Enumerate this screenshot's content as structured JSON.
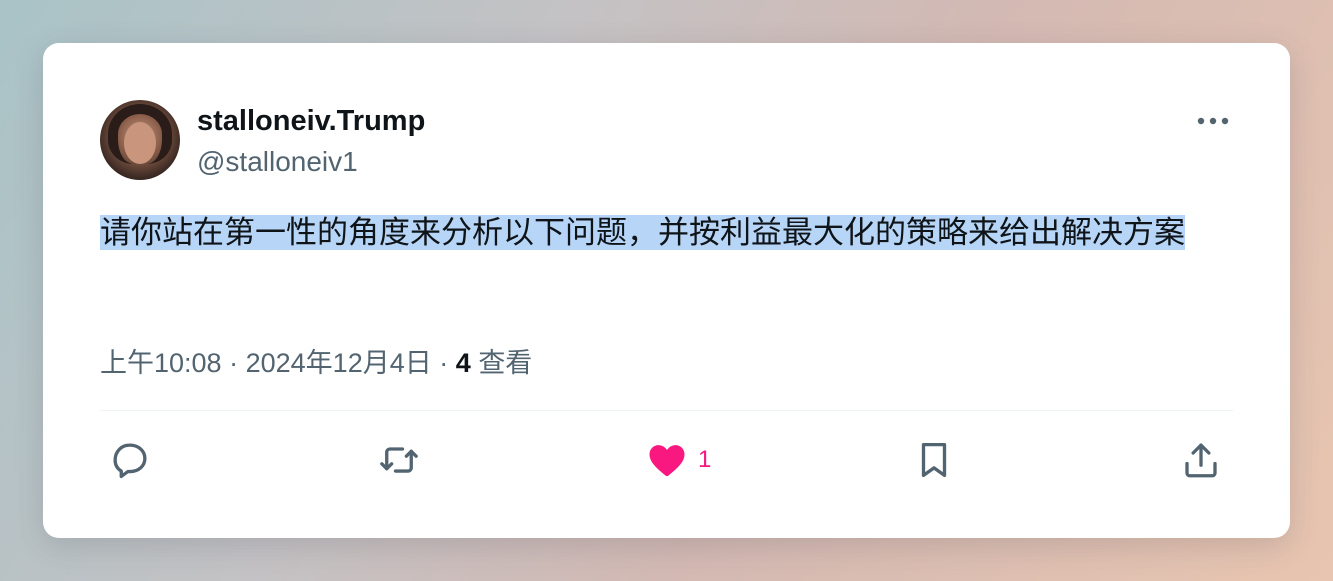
{
  "author": {
    "display_name": "stalloneiv.Trump",
    "handle": "@stalloneiv1"
  },
  "tweet": {
    "text": "请你站在第一性的角度来分析以下问题，并按利益最大化的策略来给出解决方案",
    "time": "上午10:08",
    "date": "2024年12月4日",
    "views_count": "4",
    "views_label": "查看",
    "separator": "·"
  },
  "actions": {
    "reply_icon": "reply-icon",
    "retweet_icon": "retweet-icon",
    "like_icon": "heart-icon",
    "like_count": "1",
    "bookmark_icon": "bookmark-icon",
    "share_icon": "share-icon"
  },
  "colors": {
    "like": "#f91880",
    "icon": "#536471",
    "selection": "#b7d6f7"
  }
}
